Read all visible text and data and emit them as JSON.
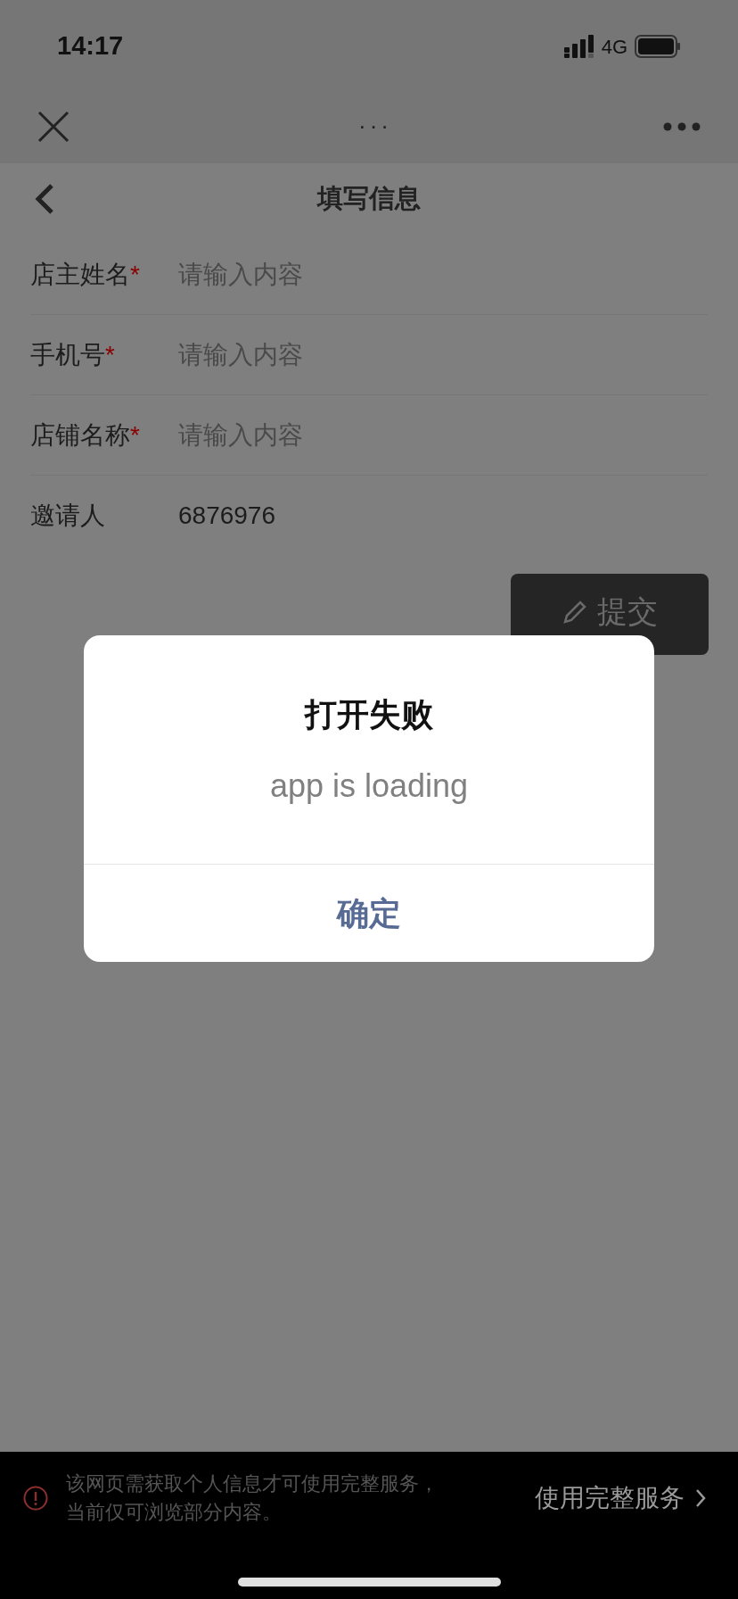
{
  "status_bar": {
    "time": "14:17",
    "network": "4G"
  },
  "nav_bar": {
    "title": "···"
  },
  "page": {
    "title": "填写信息",
    "fields": [
      {
        "label": "店主姓名",
        "required_mark": "*",
        "placeholder": "请输入内容"
      },
      {
        "label": "手机号",
        "required_mark": "*",
        "placeholder": "请输入内容"
      },
      {
        "label": "店铺名称",
        "required_mark": "*",
        "placeholder": "请输入内容"
      },
      {
        "label": "邀请人",
        "value": "6876976"
      }
    ],
    "submit": "提交"
  },
  "dialog": {
    "title": "打开失败",
    "message": "app is loading",
    "button": "确定"
  },
  "notice": {
    "lines": [
      "该网页需获取个人信息才可使用完整服务，",
      "当前仅可浏览部分内容。"
    ],
    "action": "使用完整服务"
  }
}
